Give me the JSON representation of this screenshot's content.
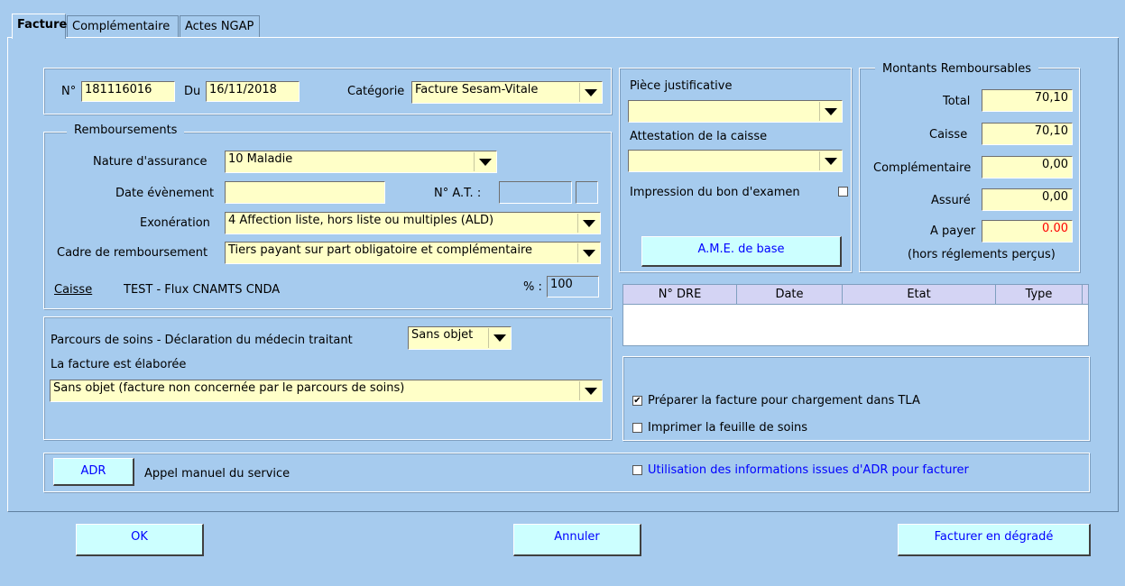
{
  "tabs": [
    "Facture",
    "Complémentaire",
    "Actes NGAP"
  ],
  "header": {
    "num_label": "N°",
    "num_value": "181116016",
    "date_label": "Du",
    "date_value": "16/11/2018",
    "categorie_label": "Catégorie",
    "categorie_value": "Facture Sesam-Vitale"
  },
  "remboursements": {
    "title": "Remboursements",
    "nature_label": "Nature d'assurance",
    "nature_value": "10  Maladie",
    "date_evt_label": "Date évènement",
    "date_evt_value": "",
    "nat_label": "N° A.T. :",
    "exoneration_label": "Exonération",
    "exoneration_value": "4  Affection liste, hors liste ou multiples (ALD)",
    "cadre_label": "Cadre de remboursement",
    "cadre_value": "Tiers payant sur part obligatoire et complémentaire",
    "caisse_link": "Caisse",
    "caisse_value": "TEST - Flux CNAMTS CNDA",
    "pct_label": "% :",
    "pct_value": "100"
  },
  "parcours": {
    "label": "Parcours de soins - Déclaration du médecin traitant",
    "value": "Sans objet",
    "elaboree_label": "La facture est élaborée",
    "elaboree_value": "Sans objet (facture non concernée par le parcours de soins)"
  },
  "adr": {
    "button": "ADR",
    "label": "Appel manuel du service",
    "checkbox_label": "Utilisation des informations issues d'ADR pour facturer"
  },
  "justif": {
    "piece_label": "Pièce justificative",
    "piece_value": "",
    "attestation_label": "Attestation de la caisse",
    "attestation_value": "",
    "impression_label": "Impression du bon d'examen",
    "ame_button": "A.M.E. de base"
  },
  "montants": {
    "title": "Montants Remboursables",
    "total_label": "Total",
    "total_value": "70,10",
    "caisse_label": "Caisse",
    "caisse_value": "70,10",
    "compl_label": "Complémentaire",
    "compl_value": "0,00",
    "assure_label": "Assuré",
    "assure_value": "0,00",
    "apayer_label": "A payer",
    "apayer_value": "0.00",
    "hors_label": "(hors réglements perçus)",
    "apayer_color": "#ff0000"
  },
  "dre_table": {
    "headers": [
      "N° DRE",
      "Date",
      "Etat",
      "Type"
    ]
  },
  "options": {
    "preparer_label": "Préparer la facture pour chargement dans TLA",
    "preparer_checked": "✔",
    "imprimer_label": "Imprimer la feuille de soins"
  },
  "buttons": {
    "ok": "OK",
    "annuler": "Annuler",
    "degrade": "Facturer en dégradé"
  }
}
